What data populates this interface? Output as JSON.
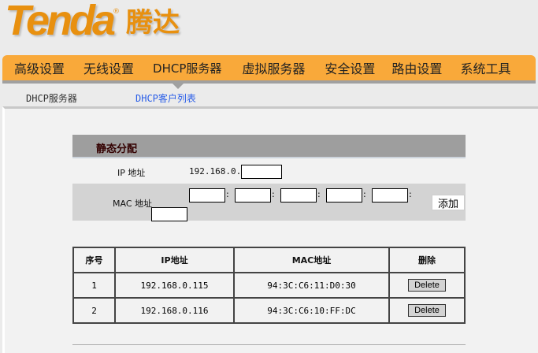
{
  "logo": {
    "en": "Tenda",
    "reg": "®",
    "cn": "腾达"
  },
  "nav": [
    "高级设置",
    "无线设置",
    "DHCP服务器",
    "虚拟服务器",
    "安全设置",
    "路由设置",
    "系统工具"
  ],
  "subnav": [
    "DHCP服务器",
    "DHCP客户列表"
  ],
  "section": {
    "title": "静态分配",
    "ip_label": "IP 地址",
    "ip_prefix": "192.168.0.",
    "mac_label": "MAC 地址",
    "colon": ":",
    "add": "添加"
  },
  "table": {
    "headers": [
      "序号",
      "IP地址",
      "MAC地址",
      "删除"
    ],
    "rows": [
      {
        "no": "1",
        "ip": "192.168.0.115",
        "mac": "94:3C:C6:11:D0:30",
        "del": "Delete"
      },
      {
        "no": "2",
        "ip": "192.168.0.116",
        "mac": "94:3C:C6:10:FF:DC",
        "del": "Delete"
      }
    ]
  }
}
